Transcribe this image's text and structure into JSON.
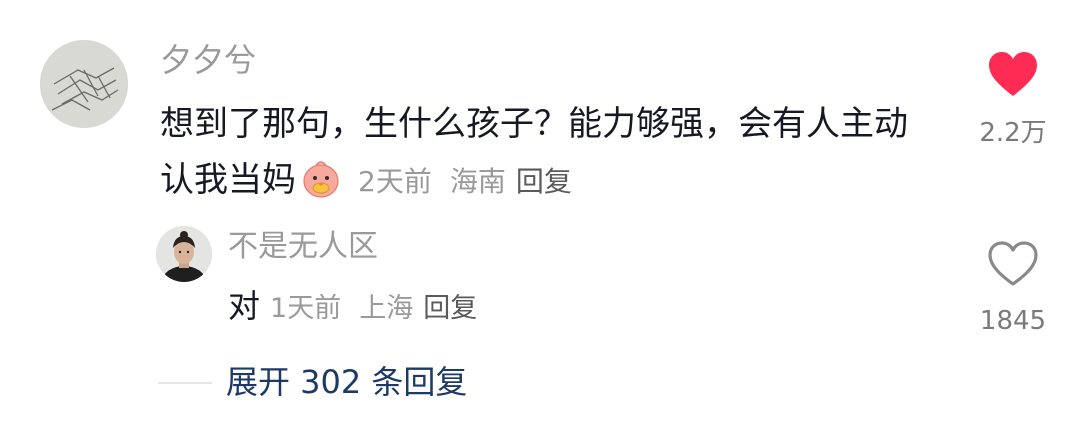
{
  "comment": {
    "username": "夕夕兮",
    "text": "想到了那句，生什么孩子？能力够强，会有人主动认我当妈",
    "emoji_icon": "peach-chick-emoji",
    "time": "2天前",
    "location": "海南",
    "reply_label": "回复",
    "like_count": "2.2万",
    "liked": true,
    "like_color": "#fe2c55"
  },
  "reply": {
    "username": "不是无人区",
    "text": "对",
    "time": "1天前",
    "location": "上海",
    "reply_label": "回复",
    "like_count": "1845",
    "liked": false
  },
  "expand": {
    "label": "展开 302 条回复",
    "color": "#1d3a66"
  }
}
